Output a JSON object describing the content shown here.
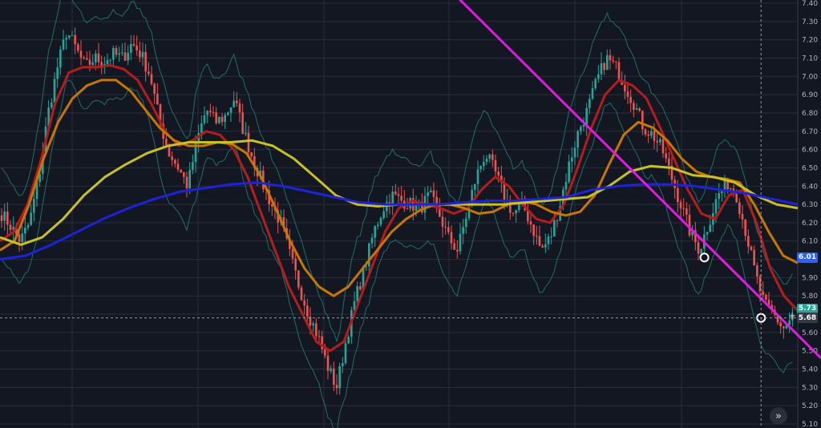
{
  "chart_data": {
    "type": "candlestick",
    "ylim": [
      5.1,
      7.4
    ],
    "y_ticks": [
      "7.40",
      "7.30",
      "7.20",
      "7.10",
      "7.00",
      "6.90",
      "6.80",
      "6.70",
      "6.60",
      "6.50",
      "6.40",
      "6.30",
      "6.20",
      "6.10",
      "6.00",
      "5.90",
      "5.80",
      "5.70",
      "5.60",
      "5.50",
      "5.40",
      "5.30",
      "5.20",
      "5.10"
    ],
    "close_path": [
      6.25,
      6.18,
      6.1,
      6.2,
      6.45,
      6.8,
      7.05,
      7.25,
      7.15,
      7.05,
      7.1,
      7.08,
      7.12,
      7.1,
      7.18,
      7.12,
      7.0,
      6.75,
      6.58,
      6.5,
      6.4,
      6.65,
      6.82,
      6.75,
      6.78,
      6.88,
      6.7,
      6.55,
      6.42,
      6.3,
      6.2,
      6.02,
      5.85,
      5.7,
      5.58,
      5.42,
      5.3,
      5.55,
      5.78,
      5.95,
      6.15,
      6.28,
      6.35,
      6.32,
      6.3,
      6.28,
      6.35,
      6.25,
      6.12,
      6.05,
      6.25,
      6.45,
      6.58,
      6.48,
      6.35,
      6.25,
      6.3,
      6.18,
      6.05,
      6.12,
      6.3,
      6.52,
      6.7,
      6.82,
      6.98,
      7.1,
      7.05,
      6.95,
      6.85,
      6.72,
      6.68,
      6.6,
      6.45,
      6.3,
      6.15,
      6.05,
      6.2,
      6.35,
      6.42,
      6.35,
      6.15,
      5.92,
      5.75,
      5.7,
      5.62,
      5.68
    ],
    "moving_averages": [
      {
        "color": "#b71c1c",
        "values": [
          6.1,
          6.15,
          6.3,
          6.55,
          6.85,
          7.02,
          7.05,
          7.05,
          7.06,
          7.04,
          6.98,
          6.85,
          6.7,
          6.62,
          6.65,
          6.7,
          6.68,
          6.6,
          6.45,
          6.25,
          6.05,
          5.85,
          5.7,
          5.55,
          5.5,
          5.55,
          5.75,
          5.95,
          6.15,
          6.28,
          6.32,
          6.3,
          6.28,
          6.25,
          6.28,
          6.38,
          6.45,
          6.4,
          6.3,
          6.22,
          6.2,
          6.3,
          6.5,
          6.72,
          6.9,
          6.98,
          6.95,
          6.88,
          6.72,
          6.55,
          6.38,
          6.25,
          6.22,
          6.35,
          6.38,
          6.2,
          5.95,
          5.8,
          5.72
        ]
      },
      {
        "color": "#c77600",
        "values": [
          6.05,
          6.1,
          6.3,
          6.55,
          6.75,
          6.88,
          6.95,
          6.98,
          6.98,
          6.92,
          6.82,
          6.72,
          6.65,
          6.62,
          6.62,
          6.64,
          6.63,
          6.58,
          6.45,
          6.28,
          6.1,
          5.95,
          5.85,
          5.8,
          5.85,
          5.95,
          6.05,
          6.15,
          6.22,
          6.27,
          6.3,
          6.3,
          6.28,
          6.25,
          6.26,
          6.3,
          6.32,
          6.3,
          6.26,
          6.24,
          6.26,
          6.35,
          6.52,
          6.68,
          6.75,
          6.72,
          6.65,
          6.55,
          6.48,
          6.45,
          6.44,
          6.42,
          6.3,
          6.15,
          6.02,
          5.98
        ]
      },
      {
        "color": "#c8c026",
        "values": [
          6.12,
          6.08,
          6.12,
          6.22,
          6.35,
          6.45,
          6.52,
          6.58,
          6.62,
          6.64,
          6.64,
          6.64,
          6.65,
          6.62,
          6.55,
          6.45,
          6.35,
          6.3,
          6.29,
          6.3,
          6.3,
          6.3,
          6.3,
          6.3,
          6.3,
          6.31,
          6.32,
          6.33,
          6.34,
          6.4,
          6.48,
          6.51,
          6.5,
          6.46,
          6.45,
          6.42,
          6.35,
          6.3,
          6.28
        ]
      },
      {
        "color": "#1e22d8",
        "values": [
          6.0,
          6.02,
          6.08,
          6.15,
          6.22,
          6.28,
          6.33,
          6.37,
          6.39,
          6.41,
          6.42,
          6.4,
          6.37,
          6.34,
          6.31,
          6.3,
          6.3,
          6.3,
          6.31,
          6.32,
          6.32,
          6.33,
          6.34,
          6.38,
          6.4,
          6.41,
          6.41,
          6.4,
          6.38,
          6.36,
          6.33,
          6.3
        ]
      }
    ],
    "trendline": {
      "color": "#e01be0",
      "from": [
        0.56,
        7.42
      ],
      "to": [
        1.0,
        5.46
      ]
    },
    "marked_points": [
      [
        0.858,
        6.01
      ],
      [
        0.927,
        5.68
      ]
    ],
    "last_price_labels": [
      {
        "value": "6.01",
        "color": "#2962ff"
      },
      {
        "value": "5.73",
        "color": "#26a69a"
      },
      {
        "value": "5.68",
        "color": "#363a45"
      }
    ],
    "grid": true
  },
  "ui": {
    "nav_button": "»",
    "crosshair_icon": "+"
  }
}
